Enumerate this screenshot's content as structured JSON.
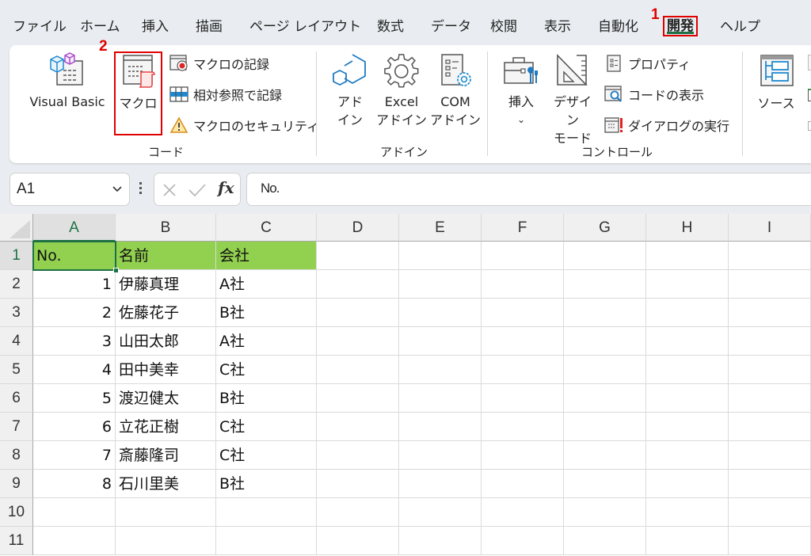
{
  "menu": {
    "tabs": [
      {
        "label": "ファイル"
      },
      {
        "label": "ホーム"
      },
      {
        "label": "挿入"
      },
      {
        "label": "描画"
      },
      {
        "label": "ページ レイアウト"
      },
      {
        "label": "数式"
      },
      {
        "label": "データ"
      },
      {
        "label": "校閲"
      },
      {
        "label": "表示"
      },
      {
        "label": "自動化"
      },
      {
        "label": "開発",
        "active": true
      },
      {
        "label": "ヘルプ"
      }
    ]
  },
  "annotations": {
    "step1": "1",
    "step2": "2",
    "highlight_color": "#e00000"
  },
  "ribbon": {
    "code_group": {
      "label": "コード",
      "visual_basic": "Visual Basic",
      "macro": "マクロ",
      "record_macro": "マクロの記録",
      "relative_ref": "相対参照で記録",
      "macro_security": "マクロのセキュリティ"
    },
    "addin_group": {
      "label": "アドイン",
      "addin_line1": "アド",
      "addin_line2": "イン",
      "excel_addin_line1": "Excel",
      "excel_addin_line2": "アドイン",
      "com_addin_line1": "COM",
      "com_addin_line2": "アドイン"
    },
    "control_group": {
      "label": "コントロール",
      "insert": "挿入",
      "design_mode_line1": "デザイン",
      "design_mode_line2": "モード",
      "properties": "プロパティ",
      "view_code": "コードの表示",
      "run_dialog": "ダイアログの実行"
    },
    "xml_group": {
      "source": "ソース"
    }
  },
  "formula_bar": {
    "name_box": "A1",
    "fx_label": "fx",
    "content": "No."
  },
  "sheet": {
    "columns": [
      "A",
      "B",
      "C",
      "D",
      "E",
      "F",
      "G",
      "H",
      "I"
    ],
    "rows": [
      "1",
      "2",
      "3",
      "4",
      "5",
      "6",
      "7",
      "8",
      "9",
      "10",
      "11"
    ],
    "header_fill": "#92d050",
    "selected_cell": "A1",
    "data": [
      [
        "No.",
        "名前",
        "会社"
      ],
      [
        "1",
        "伊藤真理",
        "A社"
      ],
      [
        "2",
        "佐藤花子",
        "B社"
      ],
      [
        "3",
        "山田太郎",
        "A社"
      ],
      [
        "4",
        "田中美幸",
        "C社"
      ],
      [
        "5",
        "渡辺健太",
        "B社"
      ],
      [
        "6",
        "立花正樹",
        "C社"
      ],
      [
        "7",
        "斎藤隆司",
        "C社"
      ],
      [
        "8",
        "石川里美",
        "B社"
      ]
    ]
  }
}
